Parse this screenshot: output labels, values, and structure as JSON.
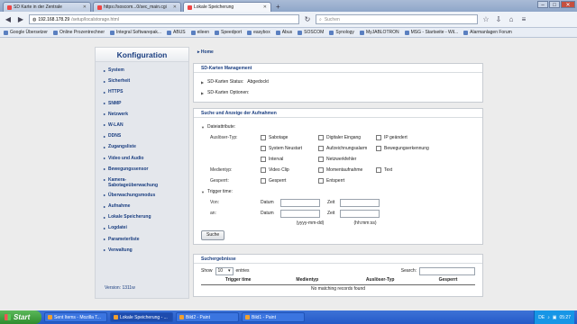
{
  "browser": {
    "tabs": [
      {
        "label": "SD Karte in der Zentrale",
        "active": false
      },
      {
        "label": "https://soscom...0/sec_main.cgi",
        "active": false
      },
      {
        "label": "Lokale Speicherung",
        "active": true
      }
    ],
    "url_host": "192.168.178.29",
    "url_path": "/setup/localstorage.html",
    "search_placeholder": "Suchen",
    "bookmarks": [
      "Google Übersetzer",
      "Online Prozentrechner",
      "Integral Softwarepak...",
      "ABUS",
      "eileen",
      "Speedport",
      "easybox",
      "Abus",
      "SOSCOM",
      "Synology",
      "MyJABLOTRON",
      "MSG - Startseite - Wil...",
      "Alarmanlagen Forum"
    ]
  },
  "sidebar": {
    "title": "Konfiguration",
    "items": [
      "System",
      "Sicherheit",
      "HTTPS",
      "SNMP",
      "Netzwerk",
      "W-LAN",
      "DDNS",
      "Zugangsliste",
      "Video und Audio",
      "Bewegungssensor",
      "Kamera-Sabotageüberwachung",
      "Überwachungsmodus",
      "Aufnahme",
      "Lokale Speicherung",
      "Logdatei",
      "Parameterliste",
      "Verwaltung"
    ],
    "version": "Version: 1311w"
  },
  "main": {
    "home": "Home",
    "sd": {
      "title": "SD-Karten Management",
      "status_label": "SD-Karten Status:",
      "status_value": "Abgedockt",
      "options_label": "SD-Karten Optionen:"
    },
    "search": {
      "title": "Suche und Anzeige der Aufnahmen",
      "file_attr": "Dateiattribute:",
      "trigger_label": "Auslöser-Typ:",
      "triggers": [
        "Sabotage",
        "Digitaler Eingang",
        "IP geändert",
        "System Neustart",
        "Aufzeichnungsalarm",
        "Bewegungserkennung",
        "Interval",
        "Netzwerkfehler"
      ],
      "media_label": "Medientyp:",
      "media": [
        "Video Clip",
        "Momentaufnahme",
        "Text"
      ],
      "locked_label": "Gesperrt:",
      "locked": [
        "Gesperrt",
        "Entsperrt"
      ],
      "trigger_time": "Trigger time:",
      "from": "Von:",
      "to": "an:",
      "date": "Datum",
      "time": "Zeit",
      "date_hint": "(yyyy-mm-dd)",
      "time_hint": "(hh:mm:ss)",
      "button": "Suche"
    },
    "results": {
      "title": "Suchergebnisse",
      "show": "Show",
      "entries": "entries",
      "per_page": "10",
      "search": "Search:",
      "columns": [
        "Trigger time",
        "Medientyp",
        "Auslöser-Typ",
        "Gesperrt"
      ],
      "empty": "No matching records found"
    }
  },
  "taskbar": {
    "start": "Start",
    "tasks": [
      "Sent Items - Mozilla T...",
      "Lokale Speicherung - ...",
      "Bild2 - Paint",
      "Bild1 - Paint"
    ],
    "lang": "DE",
    "clock": "05:27"
  }
}
